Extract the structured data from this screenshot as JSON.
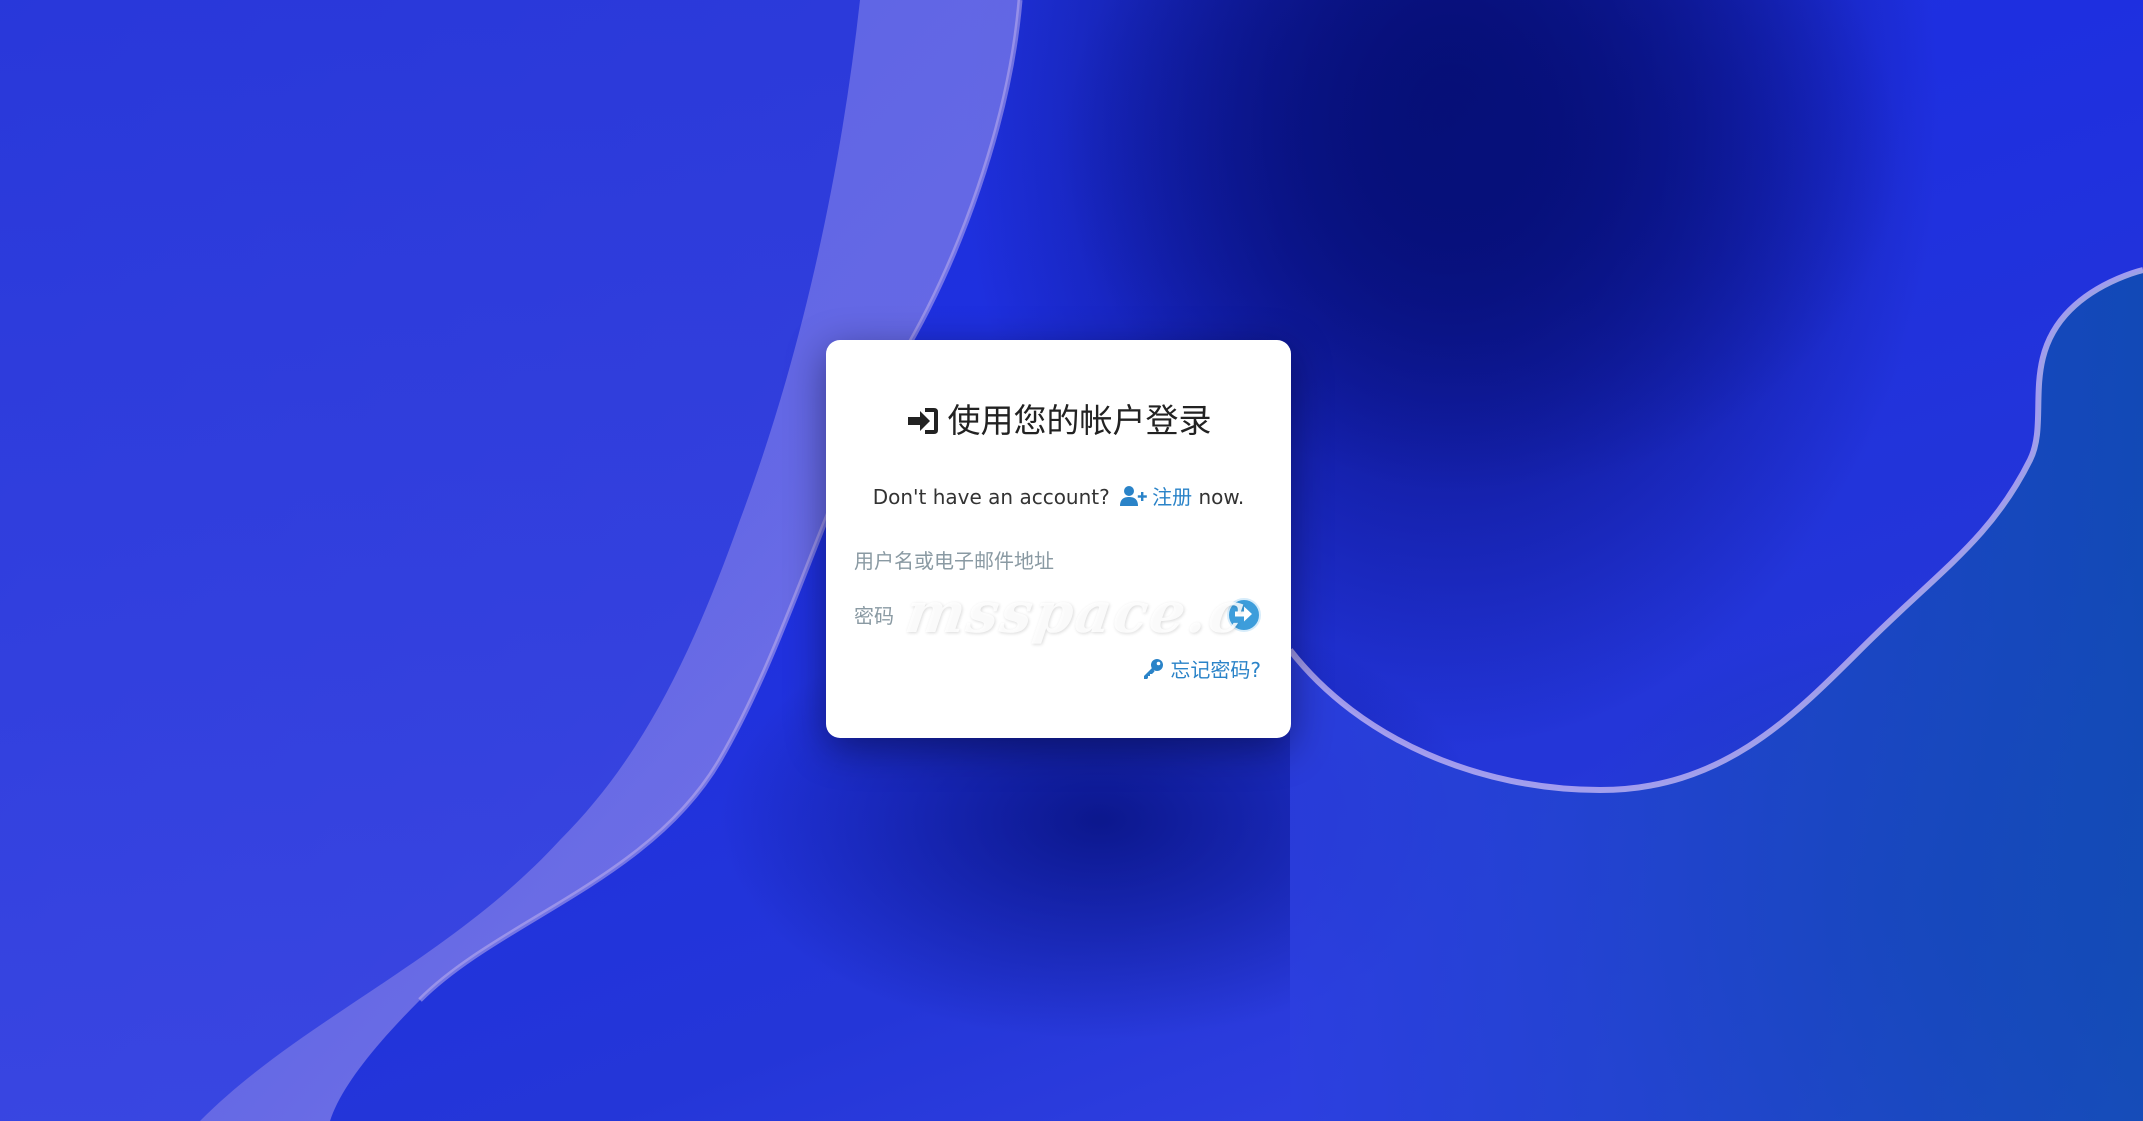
{
  "login": {
    "title": "使用您的帐户登录",
    "subtitle_prefix": "Don't have an account?",
    "register_label": "注册",
    "subtitle_suffix": "now.",
    "username_placeholder": "用户名或电子邮件地址",
    "password_placeholder": "密码",
    "forgot_label": "忘记密码?",
    "watermark": "msspace.c"
  },
  "icons": {
    "title_icon": "sign-in-icon",
    "register_icon": "user-plus-icon",
    "submit_icon": "arrow-right-circle-icon",
    "forgot_icon": "key-icon"
  },
  "colors": {
    "link": "#2a83c8",
    "submit": "#3d9ddb",
    "card": "#ffffff",
    "background": "#2034d8"
  }
}
